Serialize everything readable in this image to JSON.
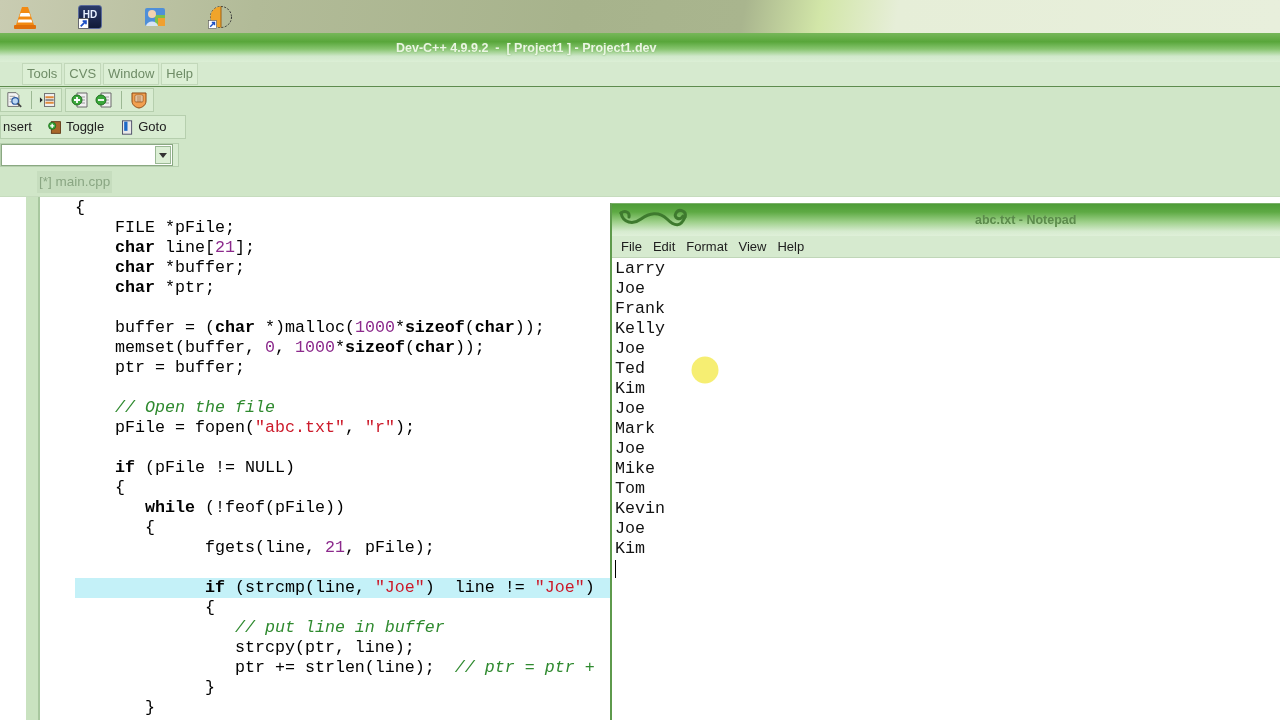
{
  "desktop": {
    "icons": [
      {
        "kind": "cone",
        "shortcut": false
      },
      {
        "kind": "hd",
        "label": "HD",
        "shortcut": true
      },
      {
        "kind": "people",
        "shortcut": false
      },
      {
        "kind": "halfdisc",
        "shortcut": true
      }
    ]
  },
  "ide": {
    "title": "Dev-C++ 4.9.9.2  -  [ Project1 ] - Project1.dev",
    "menu": [
      {
        "label": "Tools",
        "disabled": true
      },
      {
        "label": "CVS",
        "disabled": true
      },
      {
        "label": "Window",
        "disabled": true
      },
      {
        "label": "Help",
        "disabled": true
      }
    ],
    "toolbar": {
      "icon_groups": [
        {
          "items": [
            {
              "kind": "find"
            },
            {
              "kind": "separator"
            },
            {
              "kind": "indent"
            }
          ]
        },
        {
          "items": [
            {
              "kind": "add"
            },
            {
              "kind": "remove"
            },
            {
              "kind": "separator"
            },
            {
              "kind": "list"
            }
          ]
        }
      ],
      "buttons": [
        {
          "kind": "text",
          "label": "nsert"
        },
        {
          "kind": "toggle",
          "label": "Toggle"
        },
        {
          "kind": "goto",
          "label": "Goto"
        }
      ]
    },
    "tabs": [
      {
        "label": "[*] main.cpp",
        "selected": true
      }
    ],
    "editor": {
      "lines": [
        {
          "kind": "code",
          "highlighted": false,
          "tokens": [
            {
              "kind": "plain",
              "text": "{"
            }
          ]
        },
        {
          "kind": "code",
          "highlighted": false,
          "tokens": [
            {
              "kind": "plain",
              "text": "    FILE *pFile;"
            }
          ]
        },
        {
          "kind": "code",
          "highlighted": false,
          "tokens": [
            {
              "kind": "keyword",
              "text": "    char"
            },
            {
              "kind": "plain",
              "text": " line["
            },
            {
              "kind": "number",
              "text": "21"
            },
            {
              "kind": "plain",
              "text": "];"
            }
          ]
        },
        {
          "kind": "code",
          "highlighted": false,
          "tokens": [
            {
              "kind": "keyword",
              "text": "    char"
            },
            {
              "kind": "plain",
              "text": " *buffer;"
            }
          ]
        },
        {
          "kind": "code",
          "highlighted": false,
          "tokens": [
            {
              "kind": "keyword",
              "text": "    char"
            },
            {
              "kind": "plain",
              "text": " *ptr;"
            }
          ]
        },
        {
          "kind": "blank",
          "highlighted": false
        },
        {
          "kind": "code",
          "highlighted": false,
          "tokens": [
            {
              "kind": "plain",
              "text": "    buffer = ("
            },
            {
              "kind": "keyword",
              "text": "char"
            },
            {
              "kind": "plain",
              "text": " *)malloc("
            },
            {
              "kind": "number",
              "text": "1000"
            },
            {
              "kind": "plain",
              "text": "*"
            },
            {
              "kind": "keyword",
              "text": "sizeof"
            },
            {
              "kind": "plain",
              "text": "("
            },
            {
              "kind": "keyword",
              "text": "char"
            },
            {
              "kind": "plain",
              "text": "));"
            }
          ]
        },
        {
          "kind": "code",
          "highlighted": false,
          "tokens": [
            {
              "kind": "plain",
              "text": "    memset(buffer, "
            },
            {
              "kind": "number",
              "text": "0"
            },
            {
              "kind": "plain",
              "text": ", "
            },
            {
              "kind": "number",
              "text": "1000"
            },
            {
              "kind": "plain",
              "text": "*"
            },
            {
              "kind": "keyword",
              "text": "sizeof"
            },
            {
              "kind": "plain",
              "text": "("
            },
            {
              "kind": "keyword",
              "text": "char"
            },
            {
              "kind": "plain",
              "text": "));"
            }
          ]
        },
        {
          "kind": "code",
          "highlighted": false,
          "tokens": [
            {
              "kind": "plain",
              "text": "    ptr = buffer;"
            }
          ]
        },
        {
          "kind": "blank",
          "highlighted": false
        },
        {
          "kind": "code",
          "highlighted": false,
          "tokens": [
            {
              "kind": "comment",
              "text": "    // Open the file"
            }
          ]
        },
        {
          "kind": "code",
          "highlighted": false,
          "tokens": [
            {
              "kind": "plain",
              "text": "    pFile = fopen("
            },
            {
              "kind": "string",
              "text": "\"abc.txt\""
            },
            {
              "kind": "plain",
              "text": ", "
            },
            {
              "kind": "string",
              "text": "\"r\""
            },
            {
              "kind": "plain",
              "text": ");"
            }
          ]
        },
        {
          "kind": "blank",
          "highlighted": false
        },
        {
          "kind": "code",
          "highlighted": false,
          "tokens": [
            {
              "kind": "keyword",
              "text": "    if"
            },
            {
              "kind": "plain",
              "text": " (pFile != NULL)"
            }
          ]
        },
        {
          "kind": "code",
          "highlighted": false,
          "tokens": [
            {
              "kind": "plain",
              "text": "    {"
            }
          ]
        },
        {
          "kind": "code",
          "highlighted": false,
          "tokens": [
            {
              "kind": "keyword",
              "text": "       while"
            },
            {
              "kind": "plain",
              "text": " (!feof(pFile))"
            }
          ]
        },
        {
          "kind": "code",
          "highlighted": false,
          "tokens": [
            {
              "kind": "plain",
              "text": "       {"
            }
          ]
        },
        {
          "kind": "code",
          "highlighted": false,
          "tokens": [
            {
              "kind": "plain",
              "text": "             fgets(line, "
            },
            {
              "kind": "number",
              "text": "21"
            },
            {
              "kind": "plain",
              "text": ", pFile);"
            }
          ]
        },
        {
          "kind": "blank",
          "highlighted": false
        },
        {
          "kind": "code",
          "highlighted": true,
          "tokens": [
            {
              "kind": "keyword",
              "text": "             if"
            },
            {
              "kind": "plain",
              "text": " (strcmp(line, "
            },
            {
              "kind": "string",
              "text": "\"Joe\""
            },
            {
              "kind": "plain",
              "text": ")  line != "
            },
            {
              "kind": "string",
              "text": "\"Joe\""
            },
            {
              "kind": "plain",
              "text": ")"
            }
          ]
        },
        {
          "kind": "code",
          "highlighted": false,
          "tokens": [
            {
              "kind": "plain",
              "text": "             {"
            }
          ]
        },
        {
          "kind": "code",
          "highlighted": false,
          "tokens": [
            {
              "kind": "comment",
              "text": "                // put line in buffer"
            }
          ]
        },
        {
          "kind": "code",
          "highlighted": false,
          "tokens": [
            {
              "kind": "plain",
              "text": "                strcpy(ptr, line);"
            }
          ]
        },
        {
          "kind": "code",
          "highlighted": false,
          "tokens": [
            {
              "kind": "plain",
              "text": "                ptr += strlen(line);  "
            },
            {
              "kind": "comment",
              "text": "// ptr = ptr +"
            }
          ]
        },
        {
          "kind": "code",
          "highlighted": false,
          "tokens": [
            {
              "kind": "plain",
              "text": "             }"
            }
          ]
        },
        {
          "kind": "code",
          "highlighted": false,
          "tokens": [
            {
              "kind": "plain",
              "text": "       }"
            }
          ]
        }
      ]
    }
  },
  "notepad": {
    "title": "abc.txt - Notepad",
    "menu": [
      {
        "label": "File"
      },
      {
        "label": "Edit"
      },
      {
        "label": "Format"
      },
      {
        "label": "View"
      },
      {
        "label": "Help"
      }
    ],
    "lines": [
      "Larry",
      "Joe",
      "Frank",
      "Kelly",
      "Joe",
      "Ted",
      "Kim",
      "Joe",
      "Mark",
      "Joe",
      "Mike",
      "Tom",
      "Kevin",
      "Joe",
      "Kim"
    ],
    "text_cursor": true
  }
}
